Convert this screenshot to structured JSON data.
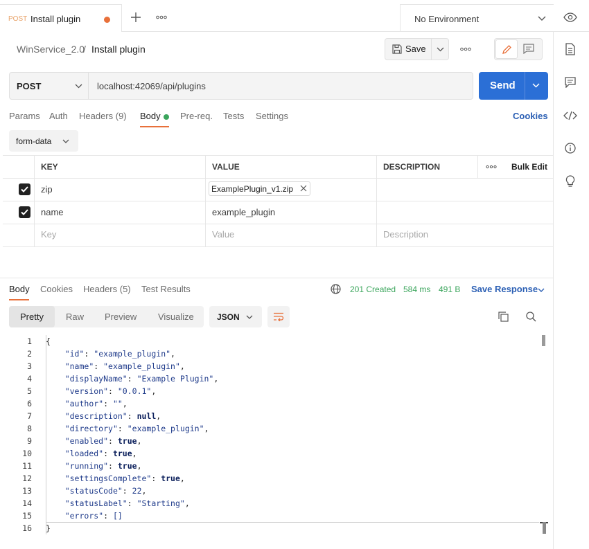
{
  "tab": {
    "method": "POST",
    "title": "Install plugin"
  },
  "environment": "No Environment",
  "breadcrumb": {
    "collection": "WinService_2.0",
    "sep": "/",
    "request": "Install plugin"
  },
  "toolbar": {
    "save_label": "Save"
  },
  "request": {
    "method": "POST",
    "url": "localhost:42069/api/plugins",
    "send_label": "Send"
  },
  "req_tabs": [
    {
      "label": "Params"
    },
    {
      "label": "Auth"
    },
    {
      "label": "Headers (9)"
    },
    {
      "label": "Body"
    },
    {
      "label": "Pre-req."
    },
    {
      "label": "Tests"
    },
    {
      "label": "Settings"
    }
  ],
  "cookies_label": "Cookies",
  "body_type": "form-data",
  "table": {
    "headers": {
      "key": "KEY",
      "value": "VALUE",
      "description": "DESCRIPTION",
      "bulk": "Bulk Edit"
    },
    "rows": [
      {
        "key": "zip",
        "value": "ExamplePlugin_v1.zip",
        "checked": true
      },
      {
        "key": "name",
        "value": "example_plugin",
        "checked": true
      }
    ],
    "placeholder": {
      "key": "Key",
      "value": "Value",
      "description": "Description"
    }
  },
  "response_tabs": [
    {
      "label": "Body"
    },
    {
      "label": "Cookies"
    },
    {
      "label": "Headers (5)"
    },
    {
      "label": "Test Results"
    }
  ],
  "response_status": {
    "status": "201 Created",
    "time": "584 ms",
    "size": "491 B",
    "save": "Save Response"
  },
  "view_modes": [
    {
      "label": "Pretty"
    },
    {
      "label": "Raw"
    },
    {
      "label": "Preview"
    },
    {
      "label": "Visualize"
    }
  ],
  "format": "JSON",
  "code_lines": [
    "{",
    "    \"id\": \"example_plugin\",",
    "    \"name\": \"example_plugin\",",
    "    \"displayName\": \"Example Plugin\",",
    "    \"version\": \"0.0.1\",",
    "    \"author\": \"\",",
    "    \"description\": null,",
    "    \"directory\": \"example_plugin\",",
    "    \"enabled\": true,",
    "    \"loaded\": true,",
    "    \"running\": true,",
    "    \"settingsComplete\": true,",
    "    \"statusCode\": 22,",
    "    \"statusLabel\": \"Starting\",",
    "    \"errors\": []",
    "}"
  ],
  "line_numbers": [
    "1",
    "2",
    "3",
    "4",
    "5",
    "6",
    "7",
    "8",
    "9",
    "10",
    "11",
    "12",
    "13",
    "14",
    "15",
    "16"
  ],
  "colors": {
    "send": "#2b6fd6",
    "accent_tab": "#e8703a",
    "green": "#3ba55c",
    "link": "#2b5fb4"
  }
}
